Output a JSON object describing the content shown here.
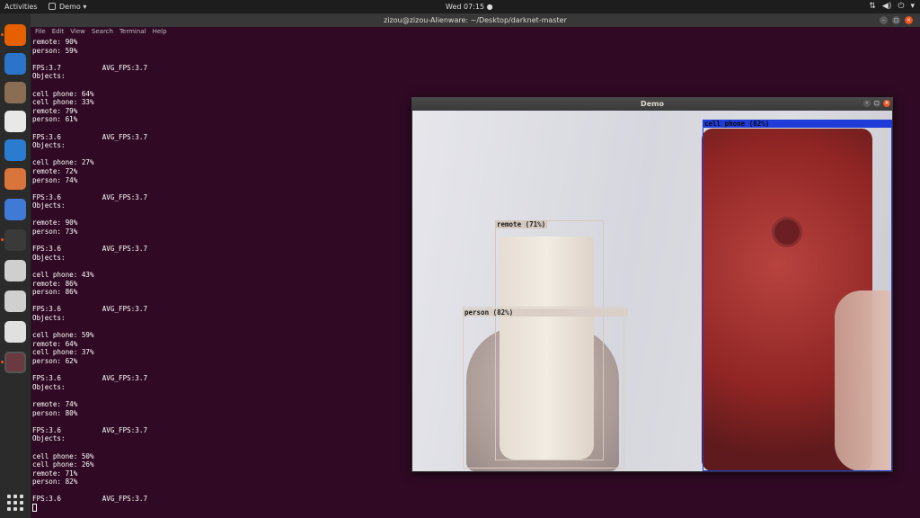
{
  "top_bar": {
    "activities": "Activities",
    "app_menu": "Demo",
    "clock": "Wed 07:15"
  },
  "dock": {
    "items": [
      {
        "icon": "firefox-icon",
        "color": "#e66000"
      },
      {
        "icon": "thunderbird-icon",
        "color": "#2a74c9"
      },
      {
        "icon": "files-icon",
        "color": "#8a6d53"
      },
      {
        "icon": "rhythmbox-icon",
        "color": "#e8e8e8"
      },
      {
        "icon": "writer-icon",
        "color": "#2b7bd0"
      },
      {
        "icon": "software-icon",
        "color": "#d9743a"
      },
      {
        "icon": "help-icon",
        "color": "#3f7ad6"
      },
      {
        "icon": "terminal-icon",
        "color": "#3a3a3a"
      },
      {
        "icon": "text-editor-icon",
        "color": "#cfcfcf"
      },
      {
        "icon": "camera-icon",
        "color": "#d0d0d0"
      },
      {
        "icon": "updater-icon",
        "color": "#e0e0e0"
      },
      {
        "icon": "demo-window-icon",
        "color": "#6b3a40"
      }
    ],
    "apps_grid_icon": "show-applications-icon"
  },
  "terminal": {
    "title": "zizou@zizou-Alienware: ~/Desktop/darknet-master",
    "menu": [
      "File",
      "Edit",
      "View",
      "Search",
      "Terminal",
      "Help"
    ],
    "lines": [
      "remote: 90%",
      "person: 59%",
      "",
      "FPS:3.7          AVG_FPS:3.7",
      "Objects:",
      "",
      "cell phone: 64%",
      "cell phone: 33%",
      "remote: 79%",
      "person: 61%",
      "",
      "FPS:3.6          AVG_FPS:3.7",
      "Objects:",
      "",
      "cell phone: 27%",
      "remote: 72%",
      "person: 74%",
      "",
      "FPS:3.6          AVG_FPS:3.7",
      "Objects:",
      "",
      "remote: 90%",
      "person: 73%",
      "",
      "FPS:3.6          AVG_FPS:3.7",
      "Objects:",
      "",
      "cell phone: 43%",
      "remote: 86%",
      "person: 86%",
      "",
      "FPS:3.6          AVG_FPS:3.7",
      "Objects:",
      "",
      "cell phone: 59%",
      "remote: 64%",
      "cell phone: 37%",
      "person: 62%",
      "",
      "FPS:3.6          AVG_FPS:3.7",
      "Objects:",
      "",
      "remote: 74%",
      "person: 80%",
      "",
      "FPS:3.6          AVG_FPS:3.7",
      "Objects:",
      "",
      "cell phone: 50%",
      "cell phone: 26%",
      "remote: 71%",
      "person: 82%",
      "",
      "FPS:3.6          AVG_FPS:3.7"
    ]
  },
  "demo_window": {
    "title": "Demo",
    "detections": [
      {
        "label": "cell phone (82%)",
        "color": "#1f3bd8",
        "text_color": "#0a0a0a"
      },
      {
        "label": "remote (71%)",
        "color": "#d4c8bc",
        "text_color": "#1a1a1a"
      },
      {
        "label": "person (82%)",
        "color": "#d9cfc6",
        "text_color": "#1a1a1a"
      }
    ]
  }
}
